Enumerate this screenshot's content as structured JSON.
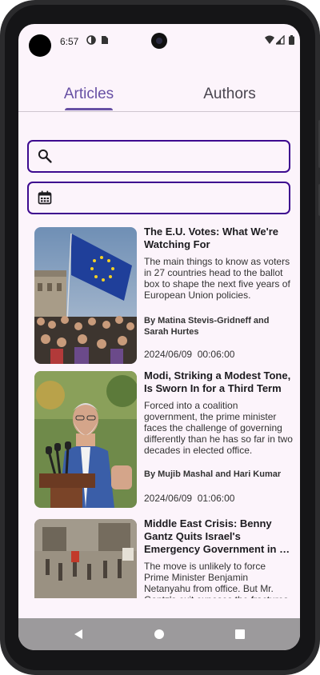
{
  "status": {
    "time": "6:57"
  },
  "tabs": [
    {
      "label": "Articles",
      "selected": true
    },
    {
      "label": "Authors",
      "selected": false
    }
  ],
  "search": {
    "icon": "search-icon",
    "value": ""
  },
  "date_filter": {
    "icon": "calendar-icon",
    "value": ""
  },
  "articles": [
    {
      "title": "The E.U. Votes: What We're Watching For",
      "description": "The main things to know as voters in 27 countries head to the ballot box to shape the next five years of European Union policies.",
      "author": "By Matina Stevis-Gridneff and Sarah Hurtes",
      "date": "2024/06/09  00:06:00"
    },
    {
      "title": "Modi, Striking a Modest Tone, Is Sworn In for a Third Term",
      "description": "Forced into a coalition government, the prime minister faces the challenge of governing differently than he has so far in two decades in elected office.",
      "author": "By Mujib Mashal and Hari Kumar",
      "date": "2024/06/09  01:06:00"
    },
    {
      "title_line1": "Middle East Crisis: Benny",
      "title_line2": "Gantz Quits Israel's",
      "title_line3": "Emergency Government in D...",
      "description": "The move is unlikely to force Prime Minister Benjamin Netanyahu from office. But Mr. Gantz's exit exposes the fractures"
    }
  ],
  "colors": {
    "accent": "#6750a4",
    "field_border": "#3d0a8f",
    "background": "#fcf4fb"
  }
}
